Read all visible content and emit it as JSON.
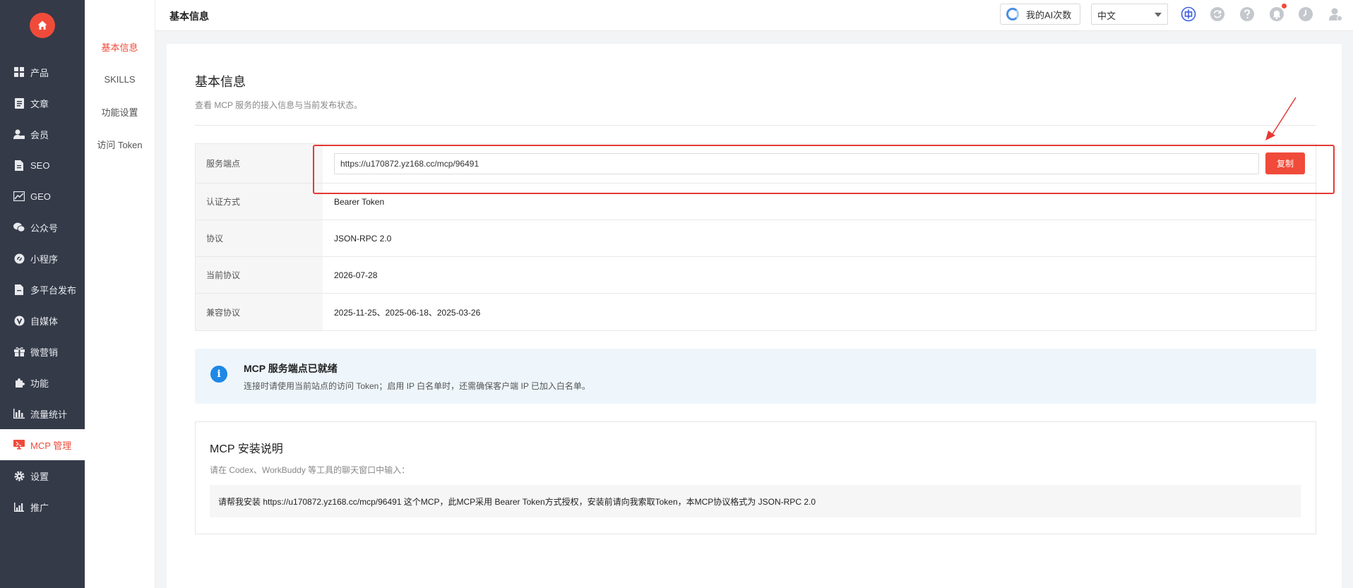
{
  "sidebar": {
    "items": [
      {
        "label": "产品",
        "icon": "grid-icon"
      },
      {
        "label": "文章",
        "icon": "document-icon"
      },
      {
        "label": "会员",
        "icon": "user-lock-icon"
      },
      {
        "label": "SEO",
        "icon": "file-icon"
      },
      {
        "label": "GEO",
        "icon": "chart-line-icon"
      },
      {
        "label": "公众号",
        "icon": "wechat-icon"
      },
      {
        "label": "小程序",
        "icon": "mini-program-icon"
      },
      {
        "label": "多平台发布",
        "icon": "file-send-icon"
      },
      {
        "label": "自媒体",
        "icon": "v-badge-icon"
      },
      {
        "label": "微营销",
        "icon": "gift-icon"
      },
      {
        "label": "功能",
        "icon": "puzzle-icon"
      },
      {
        "label": "流量统计",
        "icon": "bar-chart-icon"
      },
      {
        "label": "MCP 管理",
        "icon": "monitor-icon",
        "active": true
      },
      {
        "label": "设置",
        "icon": "gear-icon"
      },
      {
        "label": "推广",
        "icon": "stats-icon"
      }
    ]
  },
  "submenu": {
    "items": [
      "基本信息",
      "SKILLS",
      "功能设置",
      "访问 Token"
    ],
    "active_index": 0
  },
  "header": {
    "title": "基本信息",
    "ai_button_label": "我的AI次数",
    "language": "中文"
  },
  "main": {
    "title": "基本信息",
    "description": "查看 MCP 服务的接入信息与当前发布状态。",
    "rows": [
      {
        "label": "服务端点",
        "value": "https://u170872.yz168.cc/mcp/96491"
      },
      {
        "label": "认证方式",
        "value": "Bearer Token"
      },
      {
        "label": "协议",
        "value": "JSON-RPC 2.0"
      },
      {
        "label": "当前协议",
        "value": "2026-07-28"
      },
      {
        "label": "兼容协议",
        "value": "2025-11-25、2025-06-18、2025-03-26"
      }
    ],
    "copy_label": "复制",
    "notice": {
      "title": "MCP 服务端点已就绪",
      "text": "连接时请使用当前站点的访问 Token；启用 IP 白名单时，还需确保客户端 IP 已加入白名单。"
    },
    "install": {
      "title": "MCP 安装说明",
      "description": "请在 Codex、WorkBuddy 等工具的聊天窗口中输入：",
      "command": "请帮我安装 https://u170872.yz168.cc/mcp/96491 这个MCP，此MCP采用 Bearer Token方式授权，安装前请向我索取Token，本MCP协议格式为 JSON-RPC 2.0"
    }
  },
  "colors": {
    "accent": "#f04b3a",
    "sidebar_bg": "#343a48",
    "info_blue": "#1e88e5",
    "annotation_red": "#e53935"
  }
}
